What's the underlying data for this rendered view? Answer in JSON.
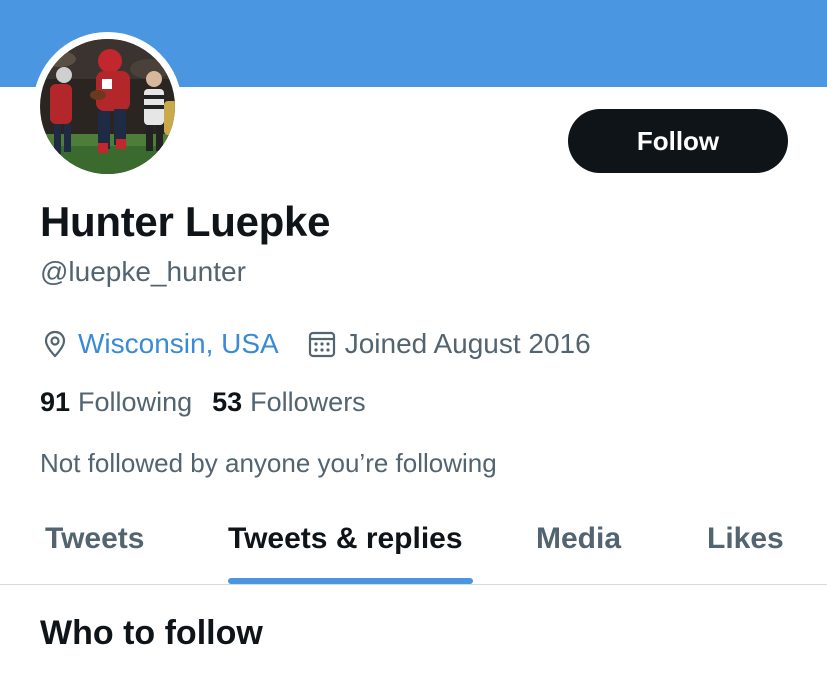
{
  "profile": {
    "display_name": "Hunter Luepke",
    "handle": "@luepke_hunter",
    "location": "Wisconsin, USA",
    "joined": "Joined August 2016",
    "following_count": "91",
    "following_label": "Following",
    "followers_count": "53",
    "followers_label": "Followers",
    "not_followed_note": "Not followed by anyone you’re following"
  },
  "actions": {
    "follow_label": "Follow"
  },
  "tabs": [
    {
      "label": "Tweets",
      "active": false
    },
    {
      "label": "Tweets & replies",
      "active": true
    },
    {
      "label": "Media",
      "active": false
    },
    {
      "label": "Likes",
      "active": false
    }
  ],
  "sections": {
    "who_to_follow": "Who to follow"
  },
  "icons": {
    "location": "location-pin-icon",
    "joined": "calendar-icon"
  },
  "colors": {
    "banner": "#4a96e0",
    "accent": "#3a8ad6",
    "primary_text": "#0f1419",
    "secondary_text": "#536471",
    "follow_button": "#0f1419"
  }
}
